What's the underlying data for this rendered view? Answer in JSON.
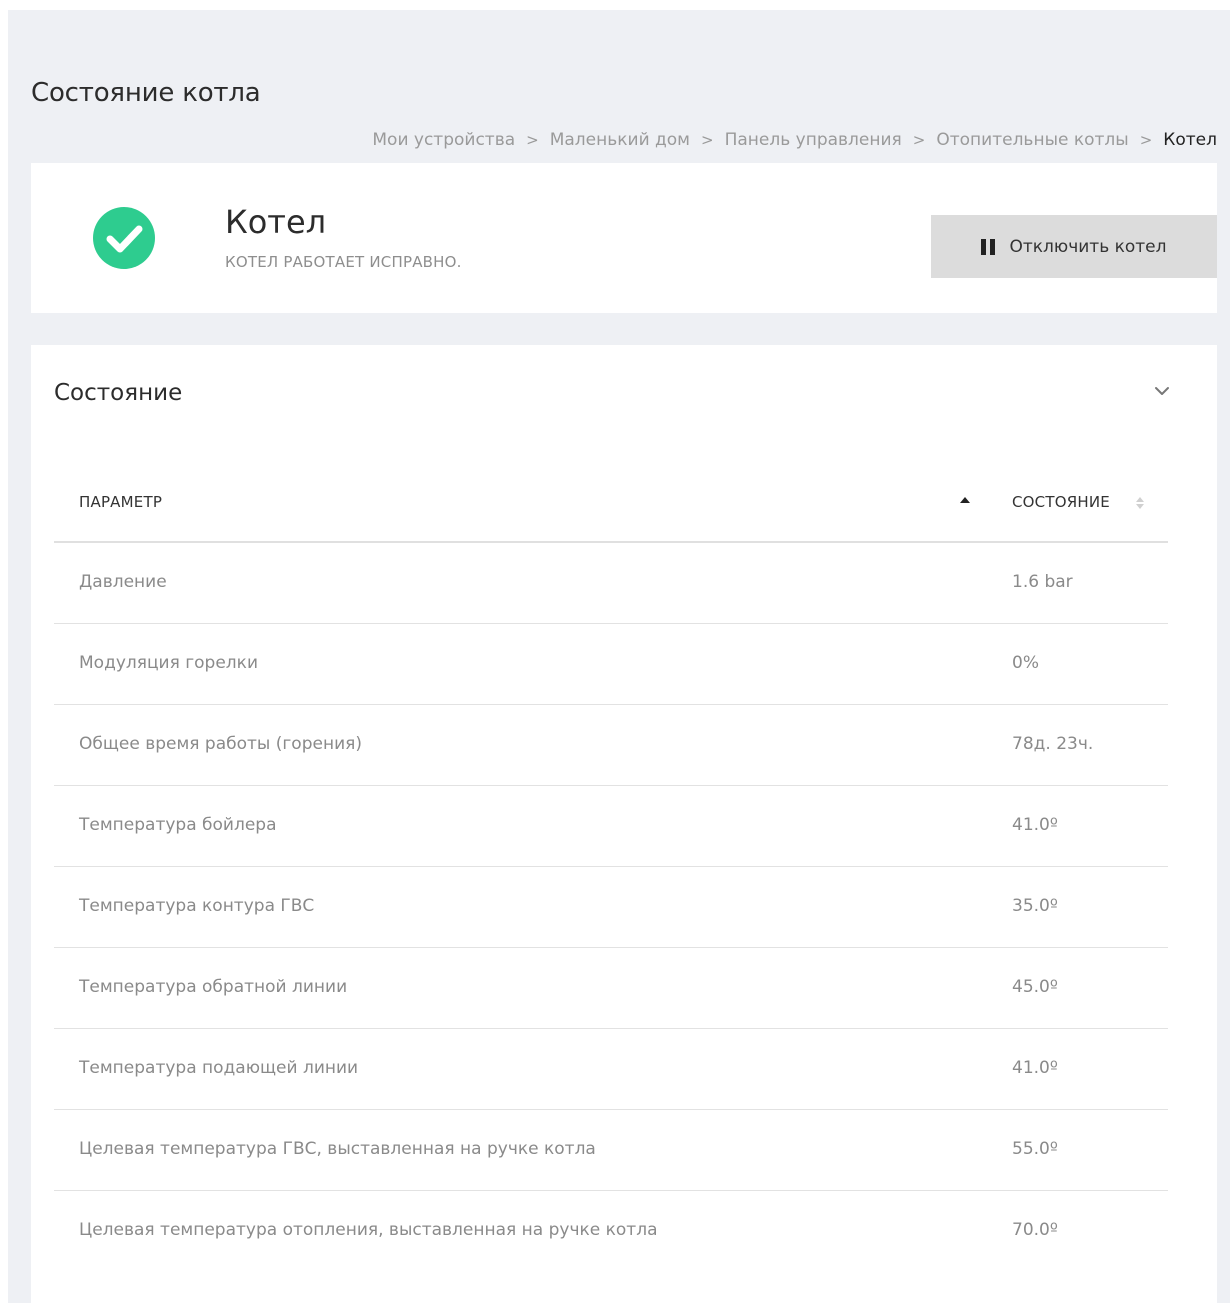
{
  "page": {
    "title": "Состояние котла"
  },
  "breadcrumb": [
    {
      "label": "Мои устройства"
    },
    {
      "label": "Маленький дом"
    },
    {
      "label": "Панель управления"
    },
    {
      "label": "Отопительные котлы"
    },
    {
      "label": "Котел"
    }
  ],
  "breadcrumb_separator": ">",
  "device": {
    "name": "Котел",
    "status_text": "КОТЕЛ РАБОТАЕТ ИСПРАВНО.",
    "status_icon": "check-circle-icon",
    "status_color": "#2ecc8f",
    "disable_button_label": "Отключить котел",
    "disable_button_icon": "pause-icon"
  },
  "state_section": {
    "title": "Состояние",
    "collapse_icon": "chevron-down-icon",
    "columns": {
      "param": "ПАРАМЕТР",
      "state": "СОСТОЯНИЕ"
    },
    "rows": [
      {
        "param": "Давление",
        "value": "1.6 bar"
      },
      {
        "param": "Модуляция горелки",
        "value": "0%"
      },
      {
        "param": "Общее время работы (горения)",
        "value": "78д. 23ч."
      },
      {
        "param": "Температура бойлера",
        "value": "41.0º"
      },
      {
        "param": "Температура контура ГВС",
        "value": "35.0º"
      },
      {
        "param": "Температура обратной линии",
        "value": "45.0º"
      },
      {
        "param": "Температура подающей линии",
        "value": "41.0º"
      },
      {
        "param": "Целевая температура ГВС, выставленная на ручке котла",
        "value": "55.0º"
      },
      {
        "param": "Целевая температура отопления, выставленная на ручке котла",
        "value": "70.0º"
      }
    ]
  },
  "colors": {
    "page_bg": "#eef0f4",
    "card_bg": "#ffffff",
    "button_bg": "#dcdcdc",
    "success": "#2ecc8f"
  }
}
